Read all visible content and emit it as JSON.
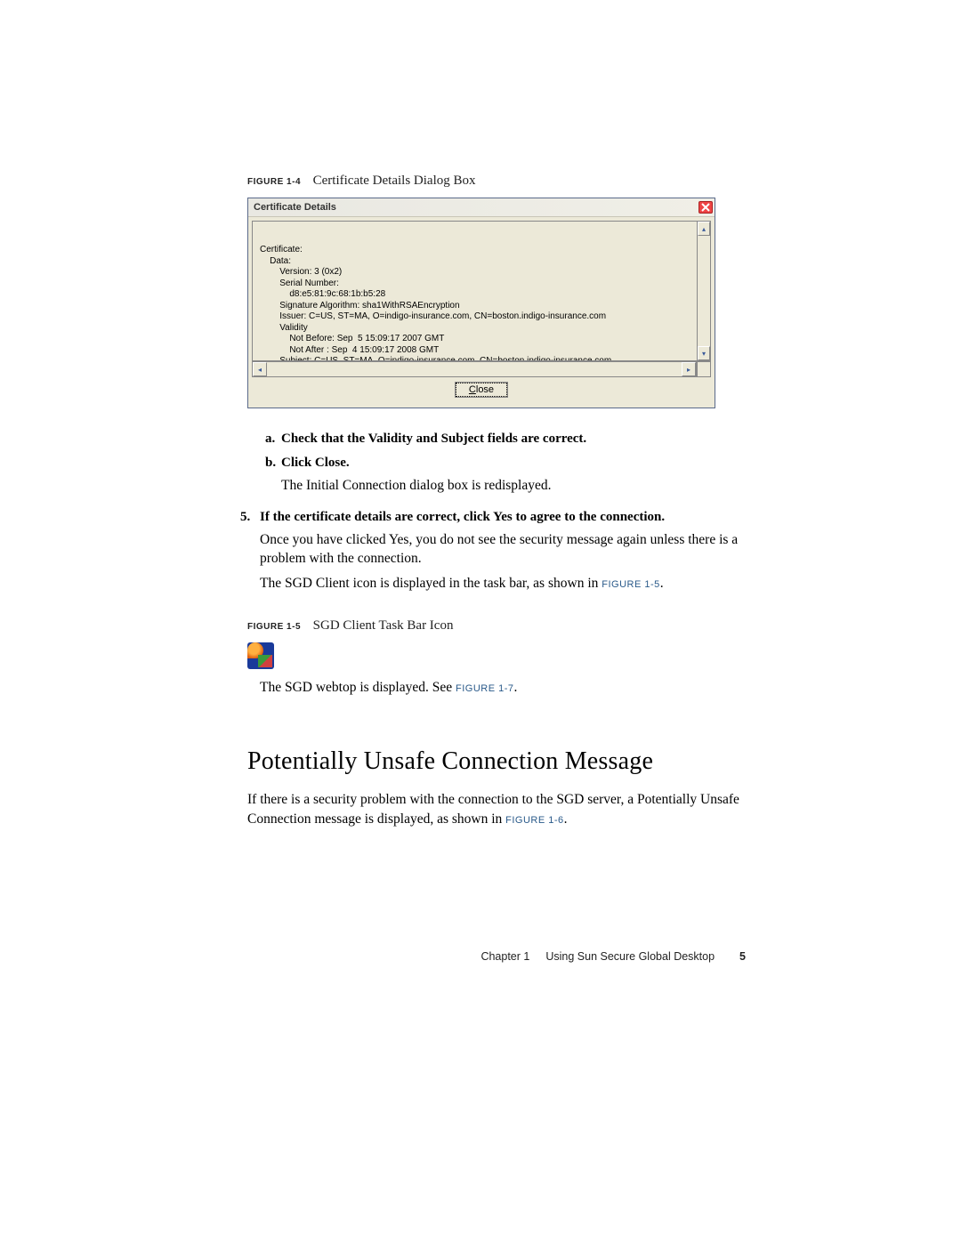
{
  "figure14": {
    "label": "FIGURE 1-4",
    "title": "Certificate Details Dialog Box"
  },
  "dialog": {
    "title": "Certificate Details",
    "cert_text": "Certificate:\n    Data:\n        Version: 3 (0x2)\n        Serial Number:\n            d8:e5:81:9c:68:1b:b5:28\n        Signature Algorithm: sha1WithRSAEncryption\n        Issuer: C=US, ST=MA, O=indigo-insurance.com, CN=boston.indigo-insurance.com\n        Validity\n            Not Before: Sep  5 15:09:17 2007 GMT\n            Not After : Sep  4 15:09:17 2008 GMT\n        Subject: C=US, ST=MA, O=indigo-insurance.com, CN=boston.indigo-insurance.com",
    "close_label_u": "C",
    "close_label_rest": "lose"
  },
  "substeps": {
    "a_marker": "a.",
    "a_text": "Check that the Validity and Subject fields are correct.",
    "b_marker": "b.",
    "b_text": "Click Close.",
    "b_plain": "The Initial Connection dialog box is redisplayed."
  },
  "step5": {
    "num": "5.",
    "bold": "If the certificate details are correct, click Yes to agree to the connection.",
    "p1": "Once you have clicked Yes, you do not see the security message again unless there is a problem with the connection.",
    "p2_pre": "The SGD Client icon is displayed in the task bar, as shown in ",
    "p2_ref": "FIGURE 1-5",
    "p2_post": "."
  },
  "figure15": {
    "label": "FIGURE 1-5",
    "title": "SGD Client Task Bar Icon"
  },
  "webtop": {
    "pre": "The SGD webtop is displayed. See ",
    "ref": "FIGURE 1-7",
    "post": "."
  },
  "section": {
    "heading": "Potentially Unsafe Connection Message",
    "para_pre": "If there is a security problem with the connection to the SGD server, a Potentially Unsafe Connection message is displayed, as shown in ",
    "para_ref": "FIGURE 1-6",
    "para_post": "."
  },
  "footer": {
    "chapter": "Chapter 1",
    "title": "Using Sun Secure Global Desktop",
    "page": "5"
  }
}
